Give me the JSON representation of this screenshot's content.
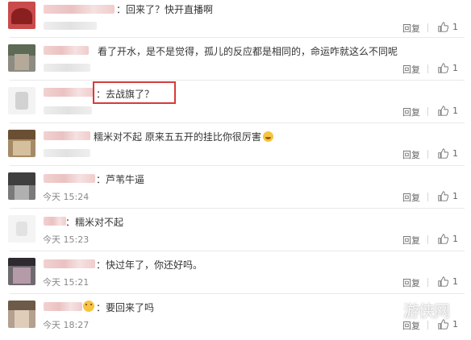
{
  "comments": [
    {
      "text": "：回来了？快开直播啊",
      "time": "",
      "reply": "回复",
      "likes": "1"
    },
    {
      "text": "看了开水，是不是觉得，孤儿的反应都是相同的，命运咋就这么不同呢",
      "time": "",
      "reply": "回复",
      "likes": "1"
    },
    {
      "text": "：去战旗了？",
      "time": "",
      "reply": "回复",
      "likes": "1"
    },
    {
      "text": "糯米对不起 原来五五开的挂比你很厉害",
      "time": "",
      "reply": "回复",
      "likes": "1"
    },
    {
      "text": "：芦苇牛逼",
      "time": "今天 15:24",
      "reply": "回复",
      "likes": "1"
    },
    {
      "text": "：糯米对不起",
      "time": "今天 15:23",
      "reply": "回复",
      "likes": "1"
    },
    {
      "text": "：快过年了，你还好吗。",
      "time": "今天 15:21",
      "reply": "回复",
      "likes": "1"
    },
    {
      "text": "：要回来了吗",
      "time": "今天 18:27",
      "reply": "回复",
      "likes": "1"
    }
  ],
  "watermark": "游侠网",
  "icons": {
    "like": "thumbs-up-icon",
    "emoji": "grin-emoji-icon"
  },
  "colors": {
    "highlight": "#d83a3a",
    "divider": "#e9e9e9",
    "muted": "#888888"
  }
}
